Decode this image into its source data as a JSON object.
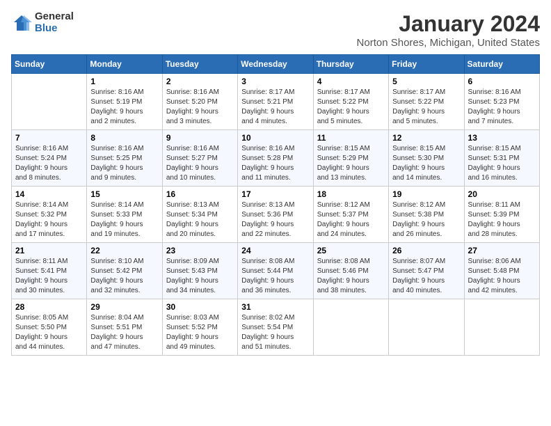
{
  "logo": {
    "general": "General",
    "blue": "Blue"
  },
  "header": {
    "month": "January 2024",
    "location": "Norton Shores, Michigan, United States"
  },
  "weekdays": [
    "Sunday",
    "Monday",
    "Tuesday",
    "Wednesday",
    "Thursday",
    "Friday",
    "Saturday"
  ],
  "weeks": [
    [
      {
        "day": "",
        "info": ""
      },
      {
        "day": "1",
        "info": "Sunrise: 8:16 AM\nSunset: 5:19 PM\nDaylight: 9 hours\nand 2 minutes."
      },
      {
        "day": "2",
        "info": "Sunrise: 8:16 AM\nSunset: 5:20 PM\nDaylight: 9 hours\nand 3 minutes."
      },
      {
        "day": "3",
        "info": "Sunrise: 8:17 AM\nSunset: 5:21 PM\nDaylight: 9 hours\nand 4 minutes."
      },
      {
        "day": "4",
        "info": "Sunrise: 8:17 AM\nSunset: 5:22 PM\nDaylight: 9 hours\nand 5 minutes."
      },
      {
        "day": "5",
        "info": "Sunrise: 8:17 AM\nSunset: 5:22 PM\nDaylight: 9 hours\nand 5 minutes."
      },
      {
        "day": "6",
        "info": "Sunrise: 8:16 AM\nSunset: 5:23 PM\nDaylight: 9 hours\nand 7 minutes."
      }
    ],
    [
      {
        "day": "7",
        "info": "Sunrise: 8:16 AM\nSunset: 5:24 PM\nDaylight: 9 hours\nand 8 minutes."
      },
      {
        "day": "8",
        "info": "Sunrise: 8:16 AM\nSunset: 5:25 PM\nDaylight: 9 hours\nand 9 minutes."
      },
      {
        "day": "9",
        "info": "Sunrise: 8:16 AM\nSunset: 5:27 PM\nDaylight: 9 hours\nand 10 minutes."
      },
      {
        "day": "10",
        "info": "Sunrise: 8:16 AM\nSunset: 5:28 PM\nDaylight: 9 hours\nand 11 minutes."
      },
      {
        "day": "11",
        "info": "Sunrise: 8:15 AM\nSunset: 5:29 PM\nDaylight: 9 hours\nand 13 minutes."
      },
      {
        "day": "12",
        "info": "Sunrise: 8:15 AM\nSunset: 5:30 PM\nDaylight: 9 hours\nand 14 minutes."
      },
      {
        "day": "13",
        "info": "Sunrise: 8:15 AM\nSunset: 5:31 PM\nDaylight: 9 hours\nand 16 minutes."
      }
    ],
    [
      {
        "day": "14",
        "info": "Sunrise: 8:14 AM\nSunset: 5:32 PM\nDaylight: 9 hours\nand 17 minutes."
      },
      {
        "day": "15",
        "info": "Sunrise: 8:14 AM\nSunset: 5:33 PM\nDaylight: 9 hours\nand 19 minutes."
      },
      {
        "day": "16",
        "info": "Sunrise: 8:13 AM\nSunset: 5:34 PM\nDaylight: 9 hours\nand 20 minutes."
      },
      {
        "day": "17",
        "info": "Sunrise: 8:13 AM\nSunset: 5:36 PM\nDaylight: 9 hours\nand 22 minutes."
      },
      {
        "day": "18",
        "info": "Sunrise: 8:12 AM\nSunset: 5:37 PM\nDaylight: 9 hours\nand 24 minutes."
      },
      {
        "day": "19",
        "info": "Sunrise: 8:12 AM\nSunset: 5:38 PM\nDaylight: 9 hours\nand 26 minutes."
      },
      {
        "day": "20",
        "info": "Sunrise: 8:11 AM\nSunset: 5:39 PM\nDaylight: 9 hours\nand 28 minutes."
      }
    ],
    [
      {
        "day": "21",
        "info": "Sunrise: 8:11 AM\nSunset: 5:41 PM\nDaylight: 9 hours\nand 30 minutes."
      },
      {
        "day": "22",
        "info": "Sunrise: 8:10 AM\nSunset: 5:42 PM\nDaylight: 9 hours\nand 32 minutes."
      },
      {
        "day": "23",
        "info": "Sunrise: 8:09 AM\nSunset: 5:43 PM\nDaylight: 9 hours\nand 34 minutes."
      },
      {
        "day": "24",
        "info": "Sunrise: 8:08 AM\nSunset: 5:44 PM\nDaylight: 9 hours\nand 36 minutes."
      },
      {
        "day": "25",
        "info": "Sunrise: 8:08 AM\nSunset: 5:46 PM\nDaylight: 9 hours\nand 38 minutes."
      },
      {
        "day": "26",
        "info": "Sunrise: 8:07 AM\nSunset: 5:47 PM\nDaylight: 9 hours\nand 40 minutes."
      },
      {
        "day": "27",
        "info": "Sunrise: 8:06 AM\nSunset: 5:48 PM\nDaylight: 9 hours\nand 42 minutes."
      }
    ],
    [
      {
        "day": "28",
        "info": "Sunrise: 8:05 AM\nSunset: 5:50 PM\nDaylight: 9 hours\nand 44 minutes."
      },
      {
        "day": "29",
        "info": "Sunrise: 8:04 AM\nSunset: 5:51 PM\nDaylight: 9 hours\nand 47 minutes."
      },
      {
        "day": "30",
        "info": "Sunrise: 8:03 AM\nSunset: 5:52 PM\nDaylight: 9 hours\nand 49 minutes."
      },
      {
        "day": "31",
        "info": "Sunrise: 8:02 AM\nSunset: 5:54 PM\nDaylight: 9 hours\nand 51 minutes."
      },
      {
        "day": "",
        "info": ""
      },
      {
        "day": "",
        "info": ""
      },
      {
        "day": "",
        "info": ""
      }
    ]
  ]
}
